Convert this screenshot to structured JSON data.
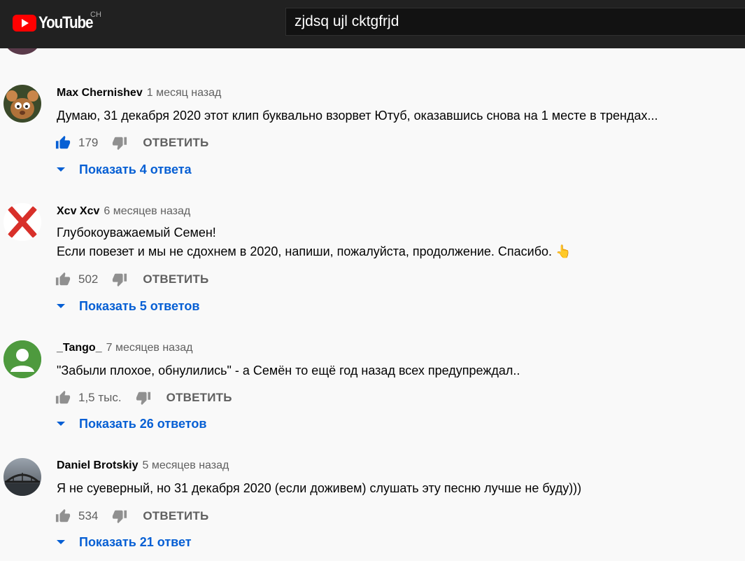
{
  "app": {
    "logo_text": "YouTube",
    "region": "CH",
    "search_value": "zjdsq ujl cktgfrjd"
  },
  "colors": {
    "topbar": "#212121",
    "link_blue": "#065fd4",
    "like_blue": "#065fd4",
    "icon_gray": "#909090"
  },
  "comments": [
    {
      "author": "Max Chernishev",
      "time": "1 месяц назад",
      "text_lines": [
        "Думаю, 31 декабря 2020 этот клип буквально взорвет Ютуб, оказавшись снова на 1 месте в трендах..."
      ],
      "likes": "179",
      "liked": true,
      "reply_label": "ОТВЕТИТЬ",
      "replies_label": "Показать 4 ответа",
      "avatar_icon": "cartoon-avatar"
    },
    {
      "author": "Xcv Xcv",
      "time": "6 месяцев назад",
      "text_lines": [
        "Глубокоуважаемый Семен!",
        "Если повезет и мы не сдохнем в 2020, напиши, пожалуйста, продолжение. Спасибо. 👆"
      ],
      "likes": "502",
      "liked": false,
      "reply_label": "ОТВЕТИТЬ",
      "replies_label": "Показать 5 ответов",
      "avatar_icon": "red-x-avatar"
    },
    {
      "author": "_Tango_",
      "time": "7 месяцев назад",
      "text_lines": [
        "\"Забыли плохое, обнулились\" - а Семён то ещё год назад всех предупреждал.."
      ],
      "likes": "1,5 тыс.",
      "liked": false,
      "reply_label": "ОТВЕТИТЬ",
      "replies_label": "Показать 26 ответов",
      "avatar_icon": "default-person-avatar"
    },
    {
      "author": "Daniel Brotskiy",
      "time": "5 месяцев назад",
      "text_lines": [
        "Я не суеверный, но 31 декабря 2020 (если доживем) слушать эту песню лучше не буду)))"
      ],
      "likes": "534",
      "liked": false,
      "reply_label": "ОТВЕТИТЬ",
      "replies_label": "Показать 21 ответ",
      "avatar_icon": "bridge-photo-avatar"
    }
  ]
}
